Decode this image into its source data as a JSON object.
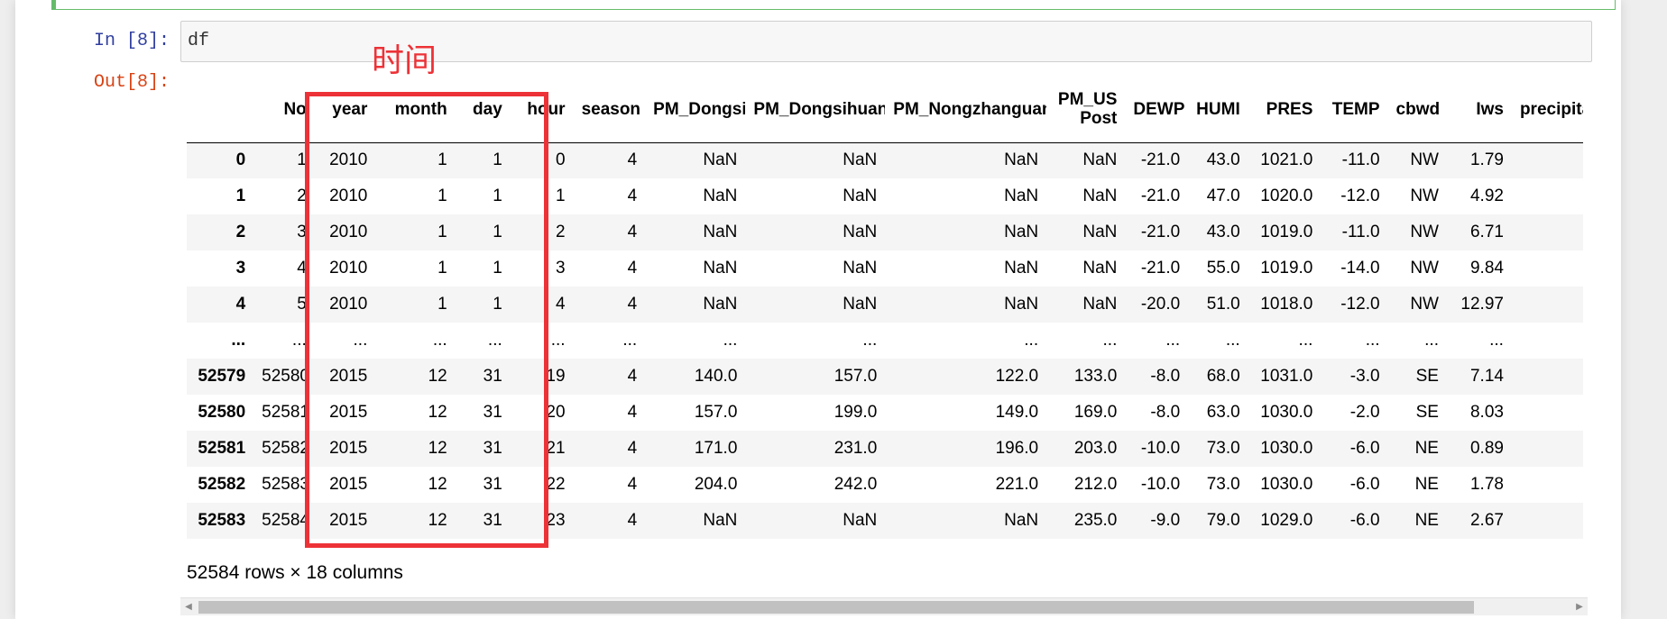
{
  "input_cell": {
    "prompt": "In  [8]:",
    "code": "df"
  },
  "output_cell": {
    "prompt": "Out[8]:"
  },
  "annotation": {
    "label": "时间",
    "color": "#ed3237"
  },
  "table": {
    "columns": [
      "",
      "No",
      "year",
      "month",
      "day",
      "hour",
      "season",
      "PM_Dongsi",
      "PM_Dongsihuan",
      "PM_Nongzhanguan",
      "PM_US Post",
      "DEWP",
      "HUMI",
      "PRES",
      "TEMP",
      "cbwd",
      "Iws",
      "precipitation"
    ],
    "rows": [
      [
        "0",
        "1",
        "2010",
        "1",
        "1",
        "0",
        "4",
        "NaN",
        "NaN",
        "NaN",
        "NaN",
        "-21.0",
        "43.0",
        "1021.0",
        "-11.0",
        "NW",
        "1.79",
        ""
      ],
      [
        "1",
        "2",
        "2010",
        "1",
        "1",
        "1",
        "4",
        "NaN",
        "NaN",
        "NaN",
        "NaN",
        "-21.0",
        "47.0",
        "1020.0",
        "-12.0",
        "NW",
        "4.92",
        ""
      ],
      [
        "2",
        "3",
        "2010",
        "1",
        "1",
        "2",
        "4",
        "NaN",
        "NaN",
        "NaN",
        "NaN",
        "-21.0",
        "43.0",
        "1019.0",
        "-11.0",
        "NW",
        "6.71",
        ""
      ],
      [
        "3",
        "4",
        "2010",
        "1",
        "1",
        "3",
        "4",
        "NaN",
        "NaN",
        "NaN",
        "NaN",
        "-21.0",
        "55.0",
        "1019.0",
        "-14.0",
        "NW",
        "9.84",
        ""
      ],
      [
        "4",
        "5",
        "2010",
        "1",
        "1",
        "4",
        "4",
        "NaN",
        "NaN",
        "NaN",
        "NaN",
        "-20.0",
        "51.0",
        "1018.0",
        "-12.0",
        "NW",
        "12.97",
        ""
      ],
      [
        "...",
        "...",
        "...",
        "...",
        "...",
        "...",
        "...",
        "...",
        "...",
        "...",
        "...",
        "...",
        "...",
        "...",
        "...",
        "...",
        "...",
        ""
      ],
      [
        "52579",
        "52580",
        "2015",
        "12",
        "31",
        "19",
        "4",
        "140.0",
        "157.0",
        "122.0",
        "133.0",
        "-8.0",
        "68.0",
        "1031.0",
        "-3.0",
        "SE",
        "7.14",
        ""
      ],
      [
        "52580",
        "52581",
        "2015",
        "12",
        "31",
        "20",
        "4",
        "157.0",
        "199.0",
        "149.0",
        "169.0",
        "-8.0",
        "63.0",
        "1030.0",
        "-2.0",
        "SE",
        "8.03",
        ""
      ],
      [
        "52581",
        "52582",
        "2015",
        "12",
        "31",
        "21",
        "4",
        "171.0",
        "231.0",
        "196.0",
        "203.0",
        "-10.0",
        "73.0",
        "1030.0",
        "-6.0",
        "NE",
        "0.89",
        ""
      ],
      [
        "52582",
        "52583",
        "2015",
        "12",
        "31",
        "22",
        "4",
        "204.0",
        "242.0",
        "221.0",
        "212.0",
        "-10.0",
        "73.0",
        "1030.0",
        "-6.0",
        "NE",
        "1.78",
        ""
      ],
      [
        "52583",
        "52584",
        "2015",
        "12",
        "31",
        "23",
        "4",
        "NaN",
        "NaN",
        "NaN",
        "235.0",
        "-9.0",
        "79.0",
        "1029.0",
        "-6.0",
        "NE",
        "2.67",
        ""
      ]
    ]
  },
  "shape_info": "52584 rows × 18 columns",
  "scrollbar": {
    "left_icon": "scroll-left-arrow-icon",
    "right_icon": "scroll-right-arrow-icon"
  }
}
